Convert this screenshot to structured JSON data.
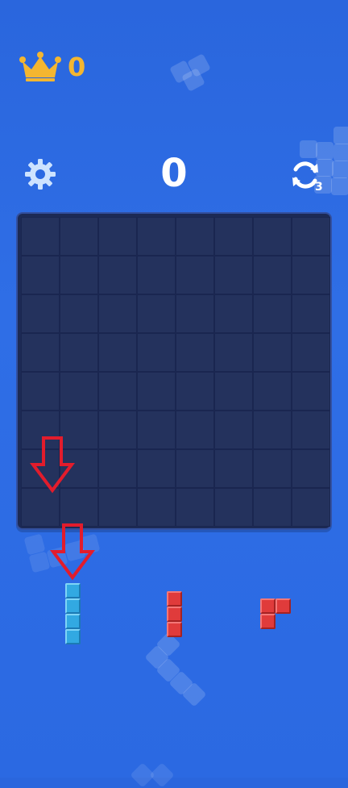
{
  "header": {
    "best_score": "0",
    "score": "0",
    "refresh_count": "3",
    "crown_icon": "crown-icon",
    "settings_icon": "gear-icon",
    "refresh_icon": "refresh-icon"
  },
  "board": {
    "rows": 8,
    "cols": 8,
    "filled_cells": []
  },
  "pieces": [
    {
      "name": "i4-vertical",
      "color": "#32a9e2"
    },
    {
      "name": "i3-vertical",
      "color": "#e03b3b"
    },
    {
      "name": "l3-corner",
      "color": "#e03b3b"
    }
  ],
  "hint_arrows": {
    "color": "#e21c2c",
    "count": 2
  },
  "colors": {
    "background": "#2b69e2",
    "board": "#1c2a55",
    "accent_gold": "#f4b630"
  }
}
